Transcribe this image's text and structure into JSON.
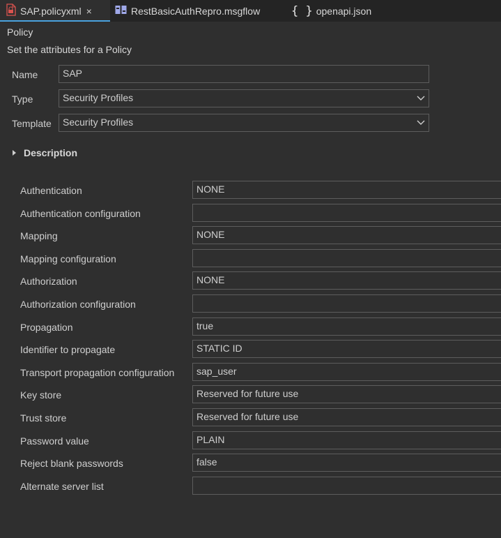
{
  "tabs": [
    {
      "label": "SAP.policyxml",
      "icon": "policy-file-icon",
      "close": "×",
      "active": true
    },
    {
      "label": "RestBasicAuthRepro.msgflow",
      "icon": "msgflow-icon",
      "active": false
    },
    {
      "label": "openapi.json",
      "icon": "json-braces-icon",
      "active": false
    }
  ],
  "policy": {
    "title": "Policy",
    "subtitle": "Set the attributes for a Policy",
    "name_label": "Name",
    "name_value": "SAP",
    "type_label": "Type",
    "type_value": "Security Profiles",
    "template_label": "Template",
    "template_value": "Security Profiles",
    "description_label": "Description"
  },
  "properties": [
    {
      "label": "Authentication",
      "value": "NONE"
    },
    {
      "label": "Authentication configuration",
      "value": ""
    },
    {
      "label": "Mapping",
      "value": "NONE"
    },
    {
      "label": "Mapping configuration",
      "value": ""
    },
    {
      "label": "Authorization",
      "value": "NONE"
    },
    {
      "label": "Authorization configuration",
      "value": ""
    },
    {
      "label": "Propagation",
      "value": "true"
    },
    {
      "label": "Identifier to propagate",
      "value": "STATIC ID"
    },
    {
      "label": "Transport propagation configuration",
      "value": "sap_user"
    },
    {
      "label": "Key store",
      "value": "Reserved for future use"
    },
    {
      "label": "Trust store",
      "value": "Reserved for future use"
    },
    {
      "label": "Password value",
      "value": "PLAIN"
    },
    {
      "label": "Reject blank passwords",
      "value": "false"
    },
    {
      "label": "Alternate server list",
      "value": ""
    }
  ],
  "colors": {
    "accent": "#4aa3df",
    "background": "#2f2f2f",
    "tabbar": "#242424",
    "border": "#5d5d5d"
  }
}
